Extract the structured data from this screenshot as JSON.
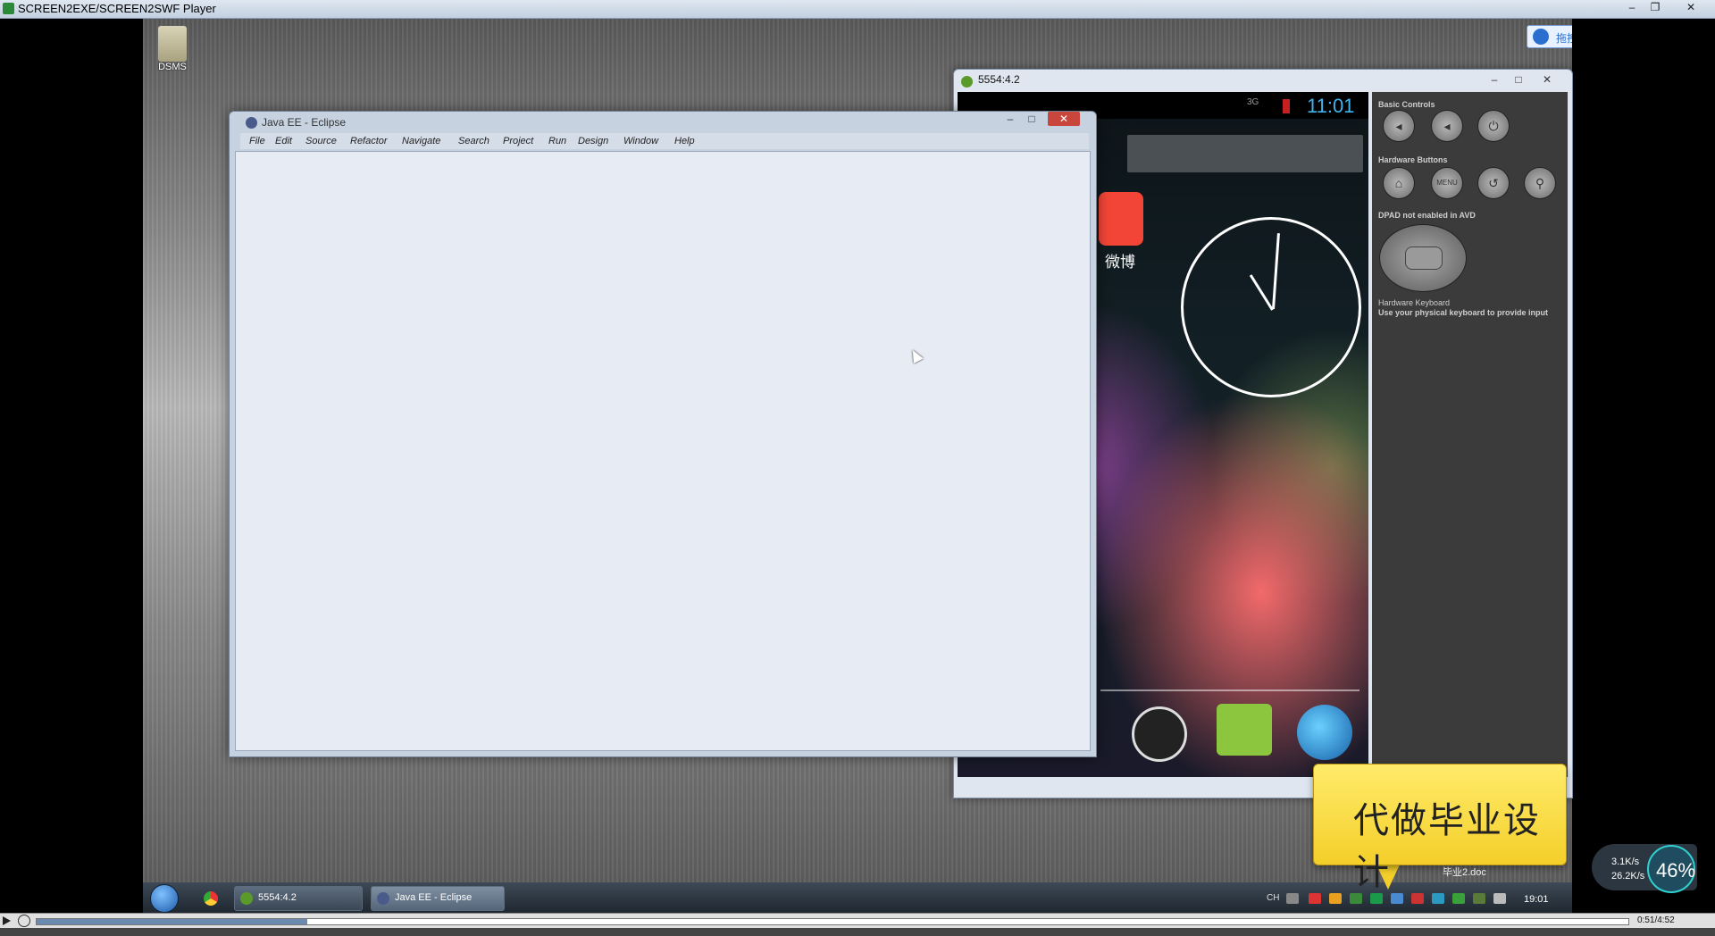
{
  "player": {
    "title": "SCREEN2EXE/SCREEN2SWF Player",
    "time": "0:51/4:52",
    "progress": 0.17
  },
  "desktop": {
    "icon_label": "DSMS",
    "baidu_button": "拖拽上传"
  },
  "emulator": {
    "title": "5554:4.2",
    "status_network": "3G",
    "status_time": "11:01",
    "weibo_label": "微博",
    "controls": {
      "basic_label": "Basic Controls",
      "hardware_label": "Hardware Buttons",
      "menu_label": "MENU",
      "dpad_label": "DPAD not enabled in AVD",
      "keyboard_label": "Hardware Keyboard",
      "keyboard_hint": "Use your physical keyboard to provide input"
    }
  },
  "eclipse": {
    "title": "Java EE - Eclipse",
    "menu": [
      "File",
      "Edit",
      "Source",
      "Refactor",
      "Navigate",
      "Search",
      "Project",
      "Run",
      "Design",
      "Window",
      "Help"
    ]
  },
  "taskbar": {
    "tasks": [
      "5554:4.2",
      "Java EE - Eclipse"
    ],
    "lang": "CH",
    "clock": "19:01"
  },
  "promo": {
    "text": "代做毕业设计",
    "doc_label": "毕业2.doc"
  },
  "net_widget": {
    "up": "3.1K/s",
    "down": "26.2K/s",
    "percent": "46%"
  },
  "colors": {
    "android_time": "#3fb5f0",
    "promo_bg": "#f4cf2a"
  }
}
